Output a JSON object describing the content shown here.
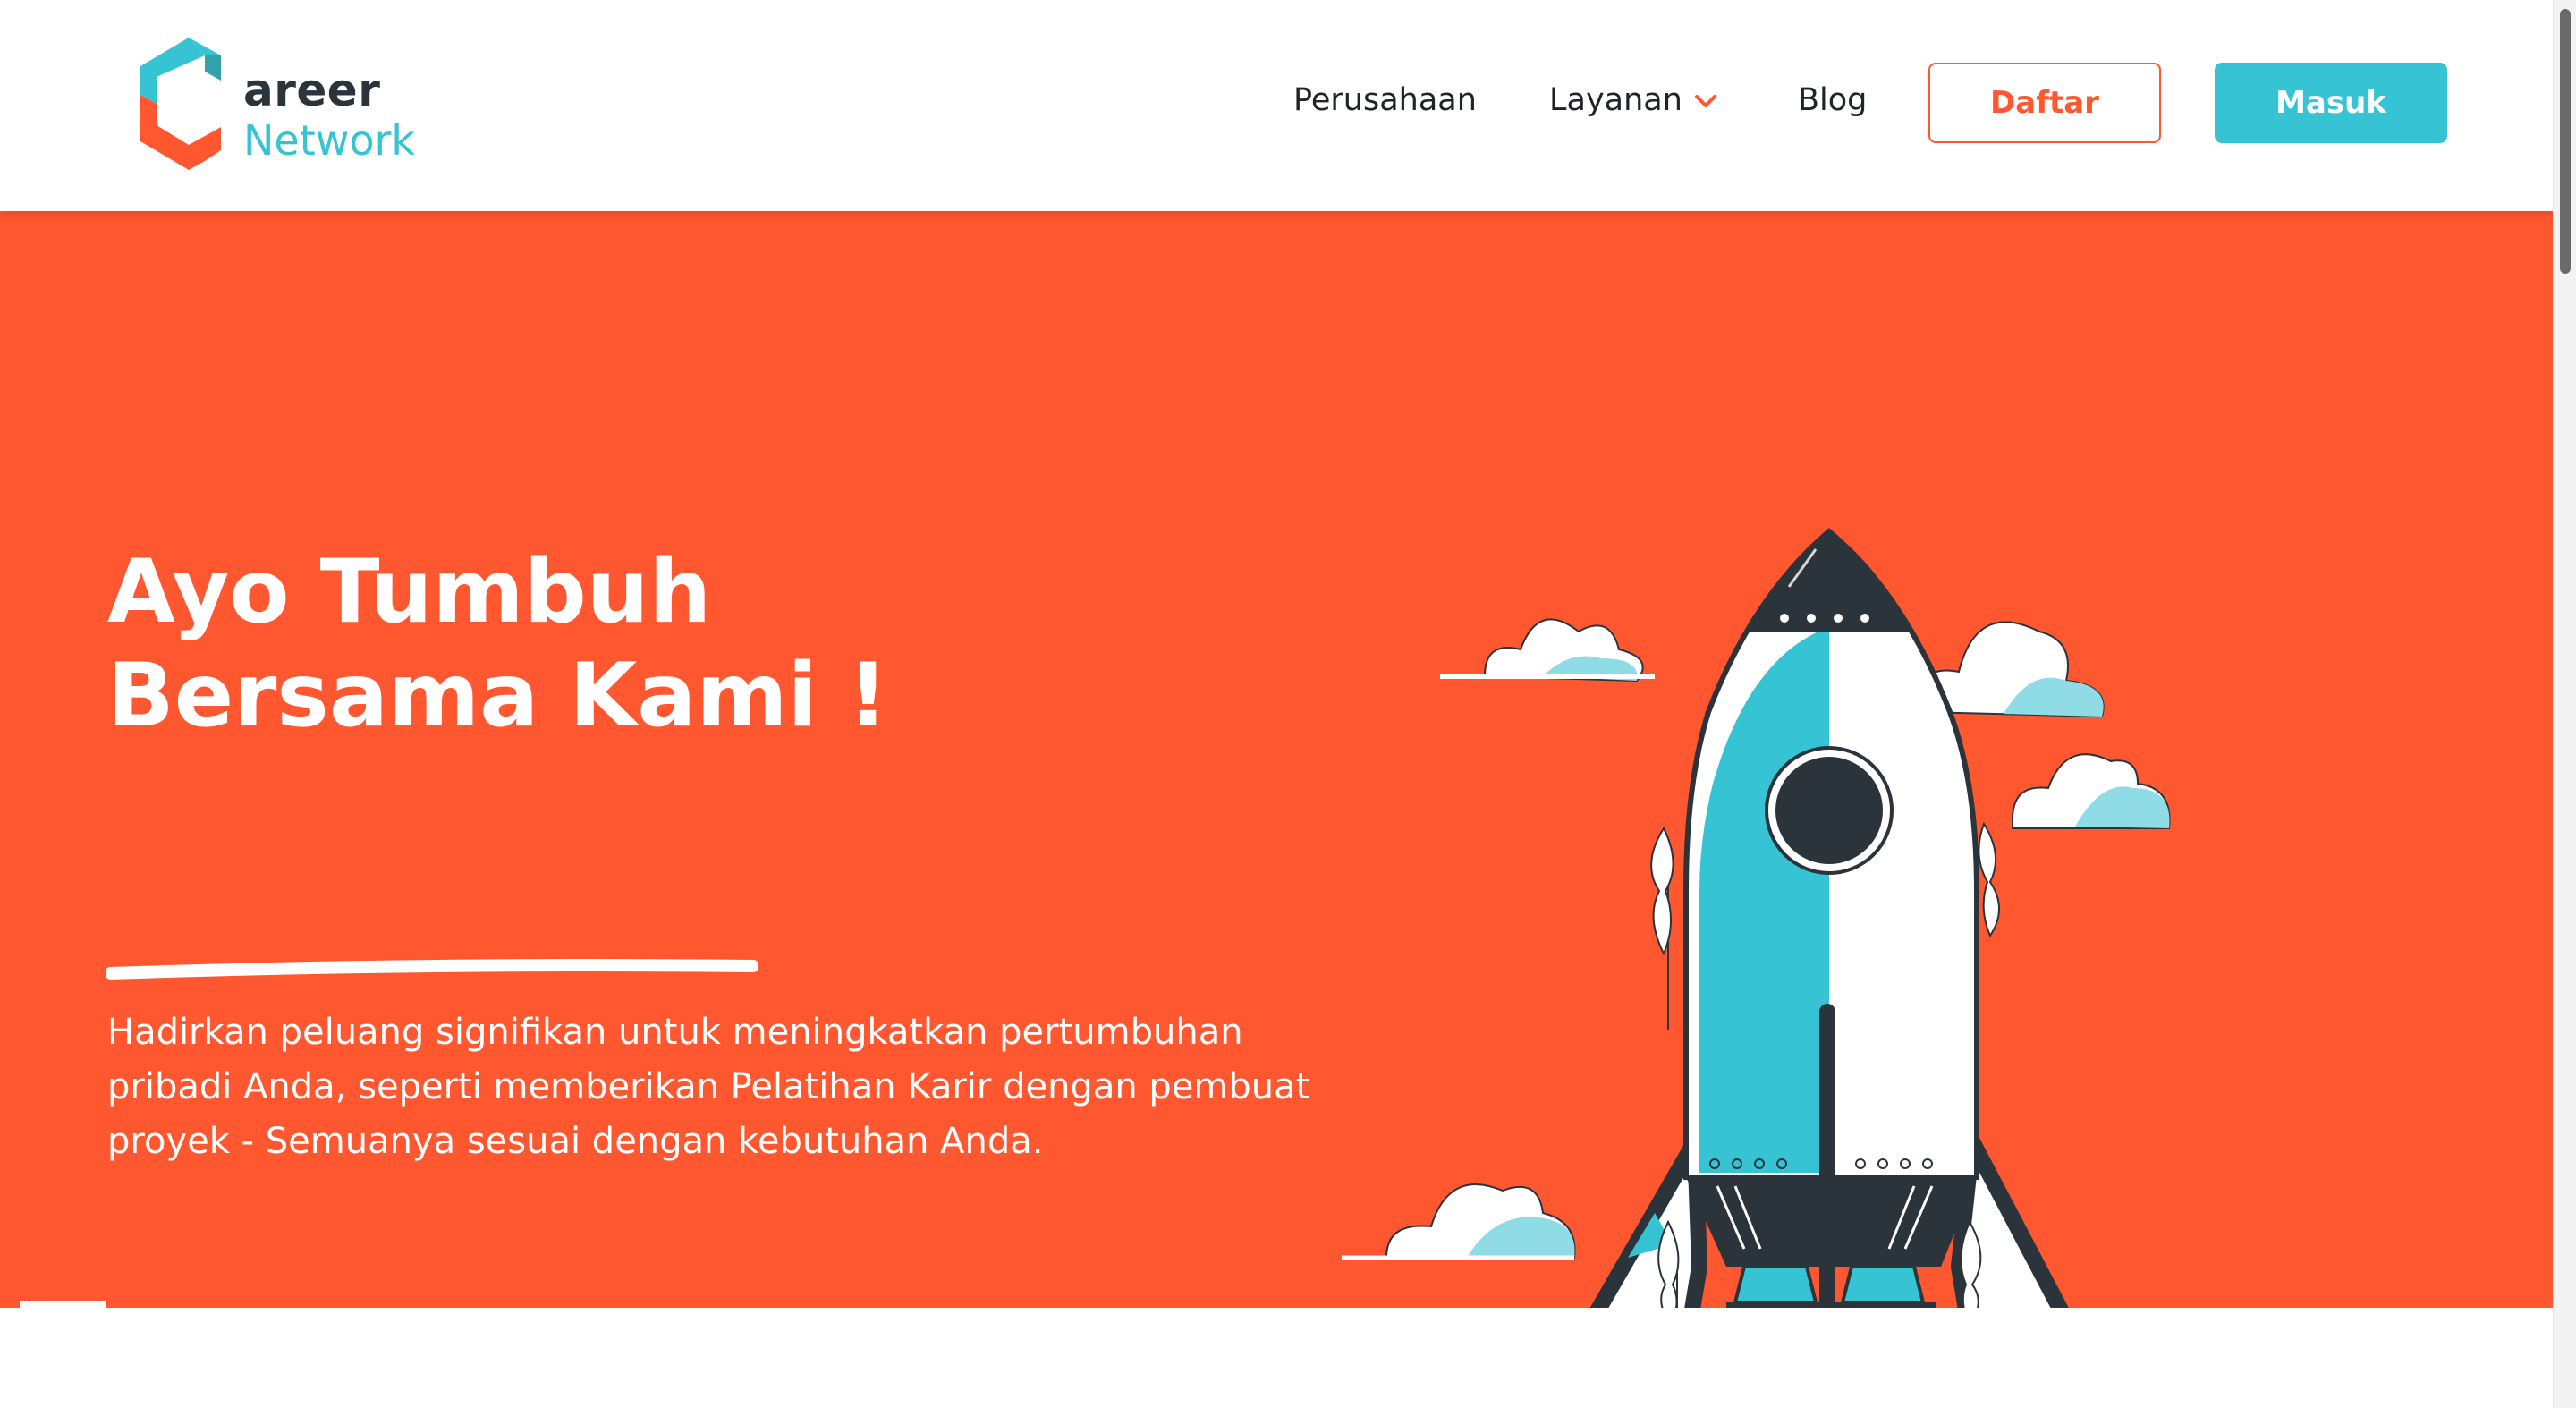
{
  "brand": {
    "word1": "areer",
    "word2": "Network",
    "colors": {
      "orange": "#ff5730",
      "teal": "#36c4d4",
      "dark": "#2b333b"
    }
  },
  "nav": {
    "perusahaan": "Perusahaan",
    "layanan": "Layanan",
    "blog": "Blog",
    "daftar": "Daftar",
    "masuk": "Masuk"
  },
  "hero": {
    "title_line1": "Ayo Tumbuh",
    "title_line2": "Bersama Kami !",
    "description": "Hadirkan peluang signifikan untuk meningkatkan pertumbuhan pribadi Anda, seperti memberikan Pelatihan Karir dengan pembuat proyek - Semuanya sesuai dengan kebutuhan Anda."
  },
  "icons": {
    "logo": "career-network-logo-icon",
    "dropdown": "chevron-down-icon",
    "illustration": "rocket-illustration"
  }
}
